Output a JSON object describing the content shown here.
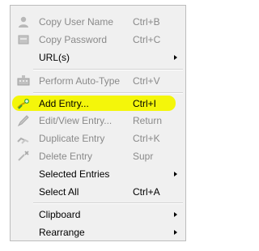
{
  "menu": {
    "items": [
      {
        "label": "Copy User Name",
        "shortcut": "Ctrl+B",
        "enabled": false,
        "icon": "user-icon"
      },
      {
        "label": "Copy Password",
        "shortcut": "Ctrl+C",
        "enabled": false,
        "icon": "password-icon"
      },
      {
        "label": "URL(s)",
        "shortcut": "",
        "enabled": true,
        "submenu": true
      },
      {
        "label": "Perform Auto-Type",
        "shortcut": "Ctrl+V",
        "enabled": false,
        "icon": "keyboard-icon"
      },
      {
        "label": "Add Entry...",
        "shortcut": "Ctrl+I",
        "enabled": true,
        "highlighted": true,
        "icon": "add-entry-icon"
      },
      {
        "label": "Edit/View Entry...",
        "shortcut": "Return",
        "enabled": false,
        "icon": "edit-icon"
      },
      {
        "label": "Duplicate Entry",
        "shortcut": "Ctrl+K",
        "enabled": false,
        "icon": "duplicate-icon"
      },
      {
        "label": "Delete Entry",
        "shortcut": "Supr",
        "enabled": false,
        "icon": "delete-icon"
      },
      {
        "label": "Selected Entries",
        "shortcut": "",
        "enabled": true,
        "submenu": true
      },
      {
        "label": "Select All",
        "shortcut": "Ctrl+A",
        "enabled": true
      },
      {
        "label": "Clipboard",
        "shortcut": "",
        "enabled": true,
        "submenu": true
      },
      {
        "label": "Rearrange",
        "shortcut": "",
        "enabled": true,
        "submenu": true
      }
    ]
  },
  "colors": {
    "highlight": "#f4f60a",
    "disabled_text": "#8a8a8a",
    "menu_bg": "#f0f0f0"
  }
}
